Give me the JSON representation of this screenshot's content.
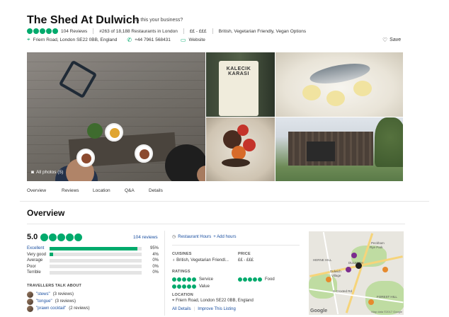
{
  "header": {
    "title": "The Shed At Dulwich",
    "claim": "Is this your business?",
    "reviews": "104 Reviews",
    "ranking": "#263 of 18,188 Restaurants in London",
    "price": "££ - £££",
    "cuisines": "British, Vegetarian Friendly, Vegan Options",
    "address": "Friern Road, London SE22 0BB, England",
    "phone": "+44 7961 568431",
    "website": "Website",
    "save": "Save",
    "rating_bubbles": 5
  },
  "photos": {
    "all_photos": "All photos (5)",
    "bottle_text": "KALECIK KARASI"
  },
  "tabs": [
    {
      "label": "Overview"
    },
    {
      "label": "Reviews"
    },
    {
      "label": "Location"
    },
    {
      "label": "Q&A"
    },
    {
      "label": "Details"
    }
  ],
  "overview": {
    "title": "Overview",
    "score": "5.0",
    "reviews_link": "104 reviews",
    "ratings": [
      {
        "label": "Excellent",
        "pct": "95%",
        "value": 95
      },
      {
        "label": "Very good",
        "pct": "4%",
        "value": 4
      },
      {
        "label": "Average",
        "pct": "0%",
        "value": 0
      },
      {
        "label": "Poor",
        "pct": "0%",
        "value": 0
      },
      {
        "label": "Terrible",
        "pct": "0%",
        "value": 0
      }
    ],
    "talk_title": "TRAVELLERS TALK ABOUT",
    "mentions": [
      {
        "term": "\"stews\"",
        "count": "(3 reviews)"
      },
      {
        "term": "\"tongue\"",
        "count": "(3 reviews)"
      },
      {
        "term": "\"prawn cocktail\"",
        "count": "(2 reviews)"
      }
    ]
  },
  "details": {
    "hours": "Restaurant Hours",
    "add_hours": "+ Add hours",
    "cuisines_label": "CUISINES",
    "cuisines_value": "British, Vegetarian Friendl...",
    "price_label": "PRICE",
    "price_value": "££ - £££",
    "ratings_label": "RATINGS",
    "service": "Service",
    "food": "Food",
    "value": "Value",
    "location_label": "LOCATION",
    "location_value": "Friern Road, London SE22 0BB, England",
    "all_details": "All Details",
    "improve": "Improve This Listing"
  },
  "map": {
    "labels": {
      "peckham": "Peckham",
      "rye_park": "Rye Park",
      "herne_hill": "HERNE HILL",
      "dulwich": "Dulwich",
      "village": "Village",
      "forest_hill": "FOREST HILL",
      "dulwich_small": "DULWICH",
      "road": "S Croxted Rd",
      "copyright": "Map data ©2017 Google",
      "google": "Google"
    }
  },
  "colors": {
    "accent": "#00aa6c",
    "link": "#1a4fa0"
  }
}
